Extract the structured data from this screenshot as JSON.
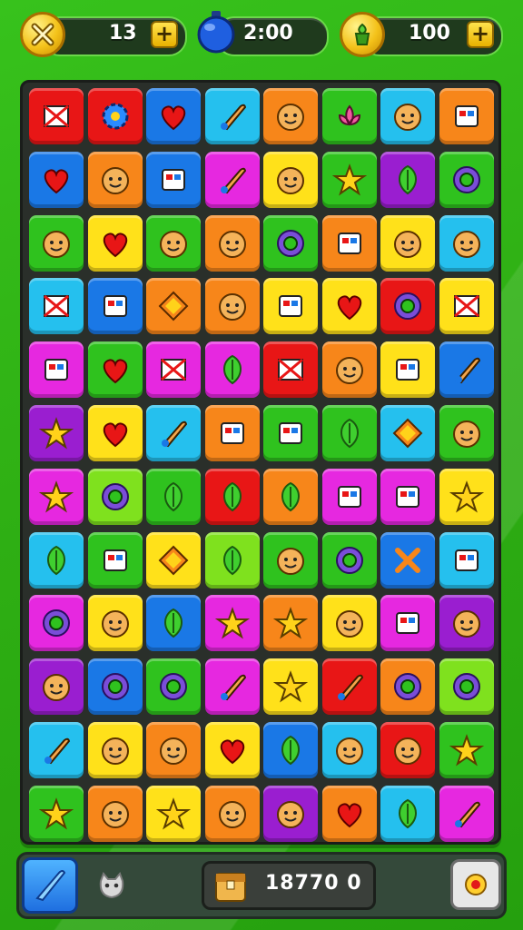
{
  "hud": {
    "moves": "13",
    "timer": "2:00",
    "coins": "100",
    "plus_label": "+"
  },
  "bottom": {
    "score": "18770 0"
  },
  "colors": {
    "red": "#e81616",
    "orange": "#f7861a",
    "yellow": "#ffe11a",
    "green": "#2fc21e",
    "lime": "#7fe11e",
    "blue": "#1a78e6",
    "cyan": "#25c0ee",
    "magenta": "#e628e0",
    "purple": "#9a1ed0"
  },
  "board": {
    "rows": [
      [
        [
          "red",
          "flag"
        ],
        [
          "red",
          "gear"
        ],
        [
          "blue",
          "heart"
        ],
        [
          "cyan",
          "brush"
        ],
        [
          "orange",
          "face"
        ],
        [
          "green",
          "lotus"
        ],
        [
          "cyan",
          "face"
        ],
        [
          "orange",
          "box"
        ]
      ],
      [
        [
          "blue",
          "heart"
        ],
        [
          "orange",
          "face"
        ],
        [
          "blue",
          "box"
        ],
        [
          "magenta",
          "brush"
        ],
        [
          "yellow",
          "face"
        ],
        [
          "green",
          "star"
        ],
        [
          "purple",
          "leaf"
        ],
        [
          "green",
          "shield"
        ]
      ],
      [
        [
          "green",
          "face"
        ],
        [
          "yellow",
          "heart"
        ],
        [
          "green",
          "face"
        ],
        [
          "orange",
          "face"
        ],
        [
          "green",
          "shield"
        ],
        [
          "orange",
          "box"
        ],
        [
          "yellow",
          "face"
        ],
        [
          "cyan",
          "face"
        ]
      ],
      [
        [
          "cyan",
          "flag"
        ],
        [
          "blue",
          "box"
        ],
        [
          "orange",
          "diamond"
        ],
        [
          "orange",
          "face"
        ],
        [
          "yellow",
          "box"
        ],
        [
          "yellow",
          "heart"
        ],
        [
          "red",
          "shield"
        ],
        [
          "yellow",
          "flag"
        ]
      ],
      [
        [
          "magenta",
          "box"
        ],
        [
          "green",
          "heart"
        ],
        [
          "magenta",
          "flag"
        ],
        [
          "magenta",
          "leaf"
        ],
        [
          "red",
          "flag"
        ],
        [
          "orange",
          "face"
        ],
        [
          "yellow",
          "box"
        ],
        [
          "blue",
          "brush"
        ]
      ],
      [
        [
          "purple",
          "star"
        ],
        [
          "yellow",
          "heart"
        ],
        [
          "cyan",
          "brush"
        ],
        [
          "orange",
          "box"
        ],
        [
          "green",
          "box"
        ],
        [
          "green",
          "leaf"
        ],
        [
          "cyan",
          "diamond"
        ],
        [
          "green",
          "face"
        ]
      ],
      [
        [
          "magenta",
          "star"
        ],
        [
          "lime",
          "shield"
        ],
        [
          "green",
          "leaf"
        ],
        [
          "red",
          "leaf"
        ],
        [
          "orange",
          "leaf"
        ],
        [
          "magenta",
          "box"
        ],
        [
          "magenta",
          "box"
        ],
        [
          "yellow",
          "star"
        ]
      ],
      [
        [
          "cyan",
          "leaf"
        ],
        [
          "green",
          "box"
        ],
        [
          "yellow",
          "diamond"
        ],
        [
          "lime",
          "leaf"
        ],
        [
          "green",
          "face"
        ],
        [
          "green",
          "shield"
        ],
        [
          "blue",
          "cross"
        ],
        [
          "cyan",
          "box"
        ]
      ],
      [
        [
          "magenta",
          "shield"
        ],
        [
          "yellow",
          "face"
        ],
        [
          "blue",
          "leaf"
        ],
        [
          "magenta",
          "star"
        ],
        [
          "orange",
          "star"
        ],
        [
          "yellow",
          "face"
        ],
        [
          "magenta",
          "box"
        ],
        [
          "purple",
          "face"
        ]
      ],
      [
        [
          "purple",
          "face"
        ],
        [
          "blue",
          "shield"
        ],
        [
          "green",
          "shield"
        ],
        [
          "magenta",
          "brush"
        ],
        [
          "yellow",
          "star"
        ],
        [
          "red",
          "brush"
        ],
        [
          "orange",
          "shield"
        ],
        [
          "lime",
          "shield"
        ]
      ],
      [
        [
          "cyan",
          "brush"
        ],
        [
          "yellow",
          "face"
        ],
        [
          "orange",
          "face"
        ],
        [
          "yellow",
          "heart"
        ],
        [
          "blue",
          "leaf"
        ],
        [
          "cyan",
          "face"
        ],
        [
          "red",
          "face"
        ],
        [
          "green",
          "star"
        ]
      ],
      [
        [
          "green",
          "star"
        ],
        [
          "orange",
          "face"
        ],
        [
          "yellow",
          "star"
        ],
        [
          "orange",
          "face"
        ],
        [
          "purple",
          "face"
        ],
        [
          "orange",
          "heart"
        ],
        [
          "cyan",
          "leaf"
        ],
        [
          "magenta",
          "brush"
        ]
      ]
    ]
  }
}
